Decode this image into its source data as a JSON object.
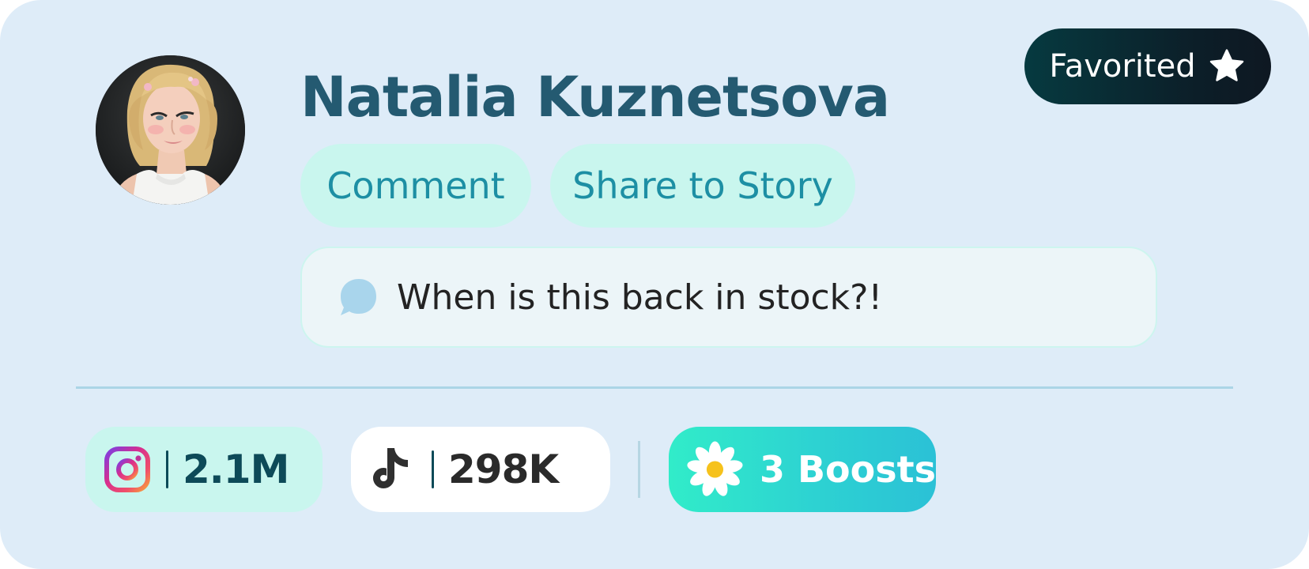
{
  "profile": {
    "name": "Natalia Kuznetsova",
    "avatar_alt": "Natalia Kuznetsova profile photo"
  },
  "favorite": {
    "label": "Favorited",
    "icon": "star-icon",
    "state": "active"
  },
  "actions": {
    "comment_label": "Comment",
    "share_label": "Share to Story"
  },
  "comment": {
    "icon": "speech-bubble-icon",
    "text": "When is this back in stock?!"
  },
  "stats": {
    "instagram": {
      "icon": "instagram-icon",
      "count": "2.1M"
    },
    "tiktok": {
      "icon": "tiktok-icon",
      "count": "298K"
    }
  },
  "boost": {
    "icon": "daisy-icon",
    "label": "3 Boosts"
  },
  "colors": {
    "card_background": "#deecf8",
    "name_text": "#245a71",
    "pill_background": "#c9f6ee",
    "pill_text": "#1d8fa4",
    "favorite_background": "#0c1e28",
    "boost_gradient_start": "#31ecc9",
    "boost_gradient_end": "#2bc1d6"
  }
}
